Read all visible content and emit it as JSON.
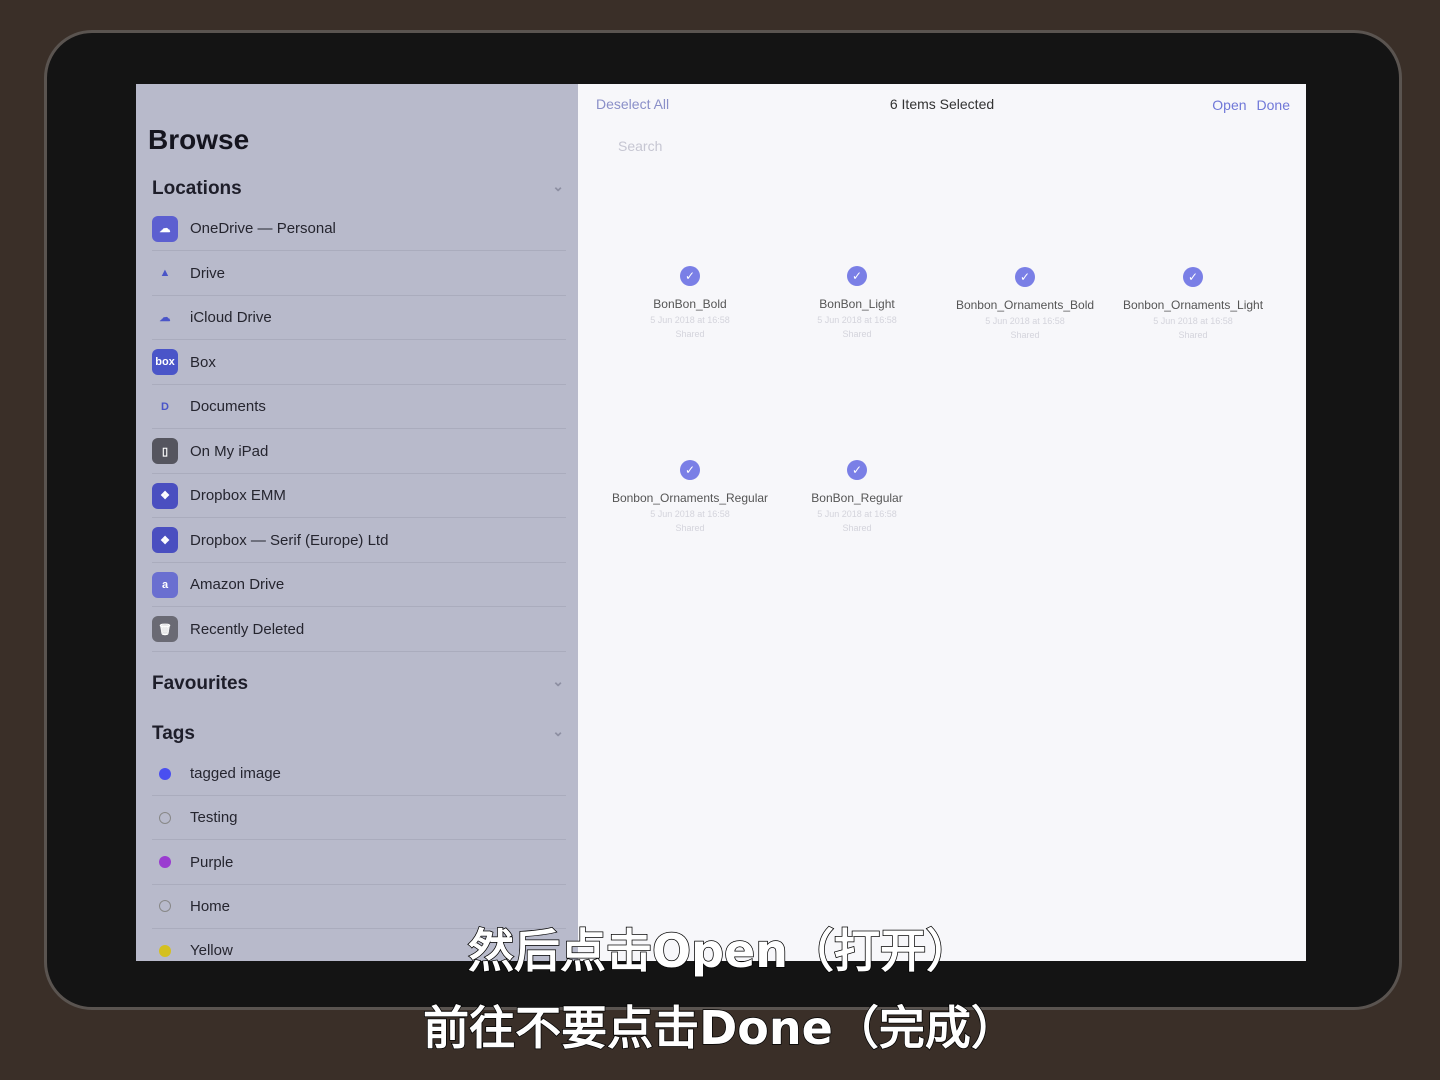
{
  "sidebar": {
    "title": "Browse",
    "locations_header": "Locations",
    "locations": [
      {
        "label": "OneDrive — Personal",
        "icon": "onedrive-icon",
        "color": "#5c5fd0",
        "glyph": "☁"
      },
      {
        "label": "Drive",
        "icon": "google-drive-icon",
        "color": "transparent",
        "glyph": "▲"
      },
      {
        "label": "iCloud Drive",
        "icon": "icloud-icon",
        "color": "transparent",
        "glyph": "☁"
      },
      {
        "label": "Box",
        "icon": "box-icon",
        "color": "#4a55c8",
        "glyph": "box"
      },
      {
        "label": "Documents",
        "icon": "documents-icon",
        "color": "transparent",
        "glyph": "D"
      },
      {
        "label": "On My iPad",
        "icon": "ipad-icon",
        "color": "#55555f",
        "glyph": "▯"
      },
      {
        "label": "Dropbox EMM",
        "icon": "dropbox-icon",
        "color": "#4a4fc0",
        "glyph": "❖"
      },
      {
        "label": "Dropbox — Serif (Europe) Ltd",
        "icon": "dropbox-icon",
        "color": "#4a4fc0",
        "glyph": "❖"
      },
      {
        "label": "Amazon Drive",
        "icon": "amazon-drive-icon",
        "color": "#6a6fd0",
        "glyph": "a"
      },
      {
        "label": "Recently Deleted",
        "icon": "trash-icon",
        "color": "#6a6a74",
        "glyph": "🗑"
      }
    ],
    "favourites_header": "Favourites",
    "tags_header": "Tags",
    "tags": [
      {
        "label": "tagged image",
        "color": "#4a4ff0"
      },
      {
        "label": "Testing",
        "color": "none"
      },
      {
        "label": "Purple",
        "color": "#9a3cd0"
      },
      {
        "label": "Home",
        "color": "none"
      },
      {
        "label": "Yellow",
        "color": "#d4c020"
      }
    ]
  },
  "nav": {
    "deselect": "Deselect All",
    "title": "6 Items Selected",
    "open": "Open",
    "done": "Done"
  },
  "search": {
    "placeholder": "Search"
  },
  "files": [
    {
      "name": "BonBon_Bold",
      "date": "5 Jun 2018 at 16:58",
      "status": "Shared",
      "selected": true
    },
    {
      "name": "BonBon_Light",
      "date": "5 Jun 2018 at 16:58",
      "status": "Shared",
      "selected": true
    },
    {
      "name": "Bonbon_Ornaments_Bold",
      "date": "5 Jun 2018 at 16:58",
      "status": "Shared",
      "selected": true
    },
    {
      "name": "Bonbon_Ornaments_Light",
      "date": "5 Jun 2018 at 16:58",
      "status": "Shared",
      "selected": true
    },
    {
      "name": "Bonbon_Ornaments_Regular",
      "date": "5 Jun 2018 at 16:58",
      "status": "Shared",
      "selected": true
    },
    {
      "name": "BonBon_Regular",
      "date": "5 Jun 2018 at 16:58",
      "status": "Shared",
      "selected": true
    }
  ],
  "subtitles": [
    "然后点击Open（打开）",
    "前往不要点击Done（完成）"
  ]
}
